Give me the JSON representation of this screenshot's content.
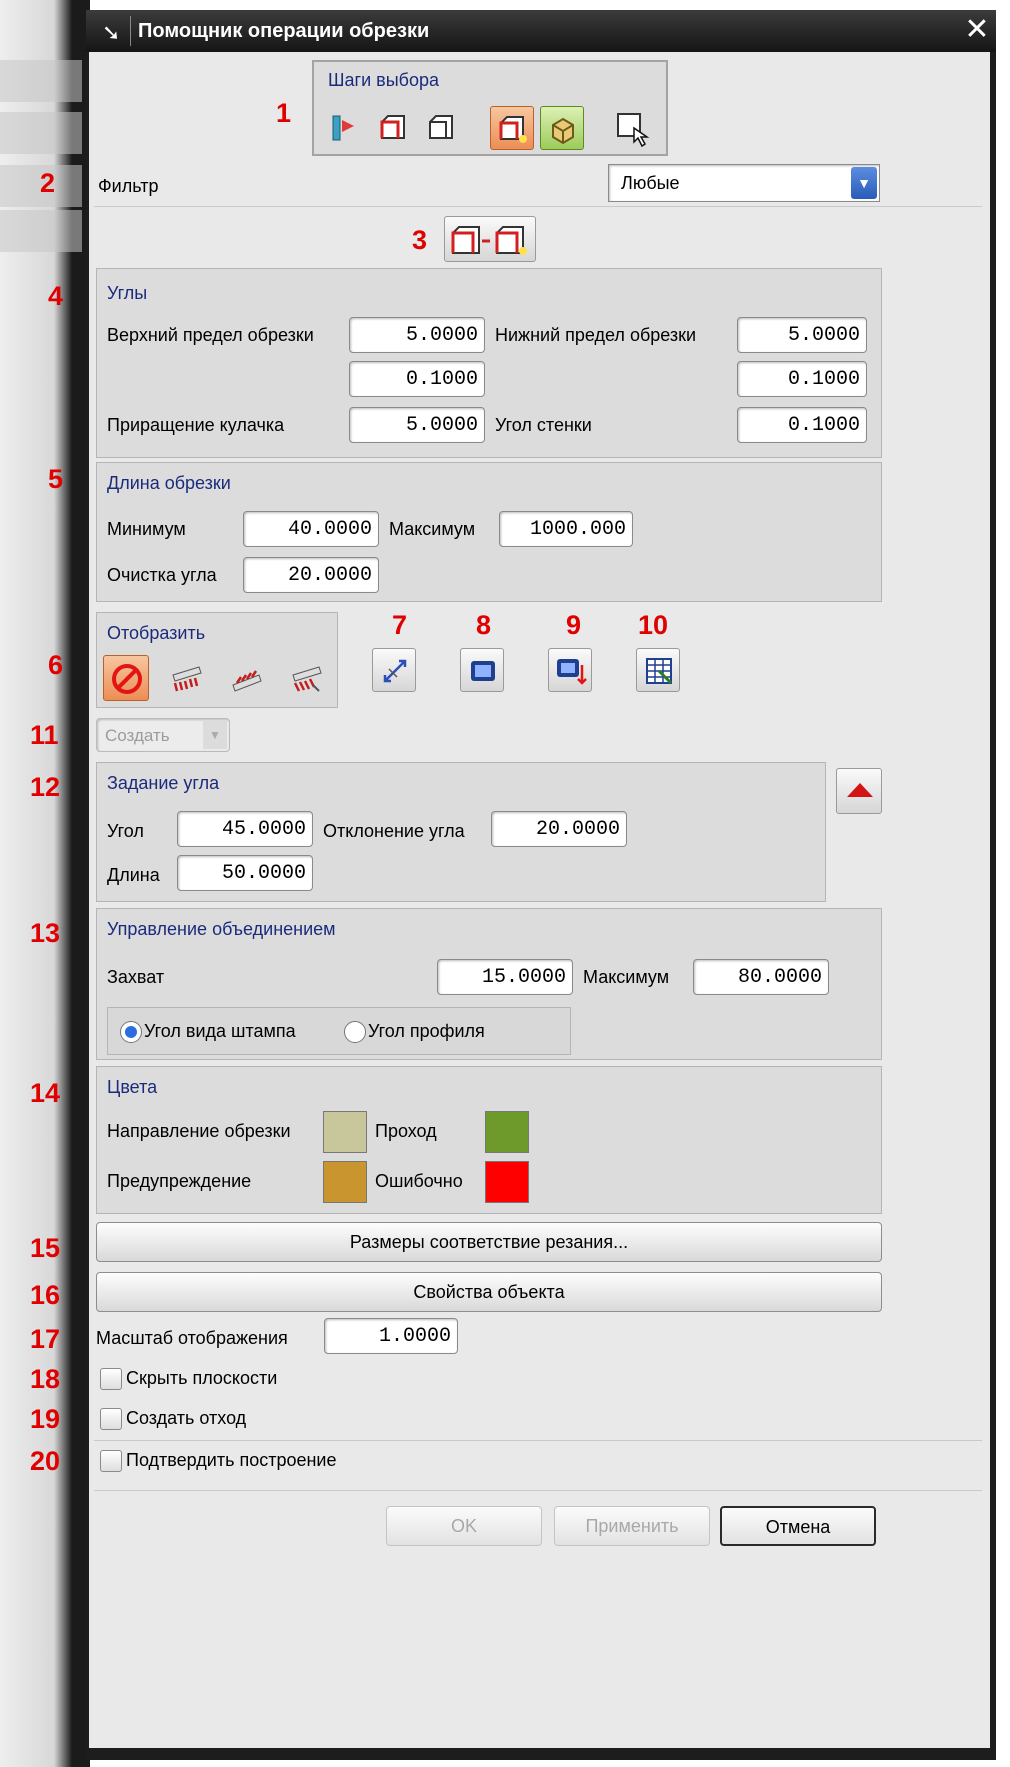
{
  "title": "Помощник операции обрезки",
  "markers": [
    "1",
    "2",
    "3",
    "4",
    "5",
    "6",
    "7",
    "8",
    "9",
    "10",
    "11",
    "12",
    "13",
    "14",
    "15",
    "16",
    "17",
    "18",
    "19",
    "20"
  ],
  "selection_steps": {
    "title": "Шаги выбора",
    "icons": [
      "sheet-edge-icon",
      "trim-face-icon",
      "trim-face-outline-icon",
      "trim-face-active-icon",
      "solid-body-icon",
      "pointer-select-icon"
    ]
  },
  "filter": {
    "label": "Фильтр",
    "value": "Любые"
  },
  "angles": {
    "title": "Углы",
    "upper_limit_label": "Верхний предел обрезки",
    "upper_limit": "5.0000",
    "upper_limit_tol": "0.1000",
    "lower_limit_label": "Нижний предел обрезки",
    "lower_limit": "5.0000",
    "lower_limit_tol": "0.1000",
    "cam_increment_label": "Приращение кулачка",
    "cam_increment": "5.0000",
    "wall_angle_label": "Угол стенки",
    "wall_angle": "0.1000"
  },
  "trim_length": {
    "title": "Длина обрезки",
    "min_label": "Минимум",
    "min": "40.0000",
    "max_label": "Максимум",
    "max": "1000.000",
    "corner_label": "Очистка угла",
    "corner": "20.0000"
  },
  "display": {
    "title": "Отобразить"
  },
  "create": {
    "value": "Создать"
  },
  "angle_setting": {
    "title": "Задание угла",
    "angle_label": "Угол",
    "angle": "45.0000",
    "deviation_label": "Отклонение угла",
    "deviation": "20.0000",
    "length_label": "Длина",
    "length": "50.0000"
  },
  "merge_control": {
    "title": "Управление объединением",
    "capture_label": "Захват",
    "capture": "15.0000",
    "max_label": "Максимум",
    "max": "80.0000",
    "radio_1": "Угол вида штампа",
    "radio_2": "Угол профиля"
  },
  "colors": {
    "title": "Цвета",
    "trim_direction_label": "Направление обрезки",
    "pass_label": "Проход",
    "warning_label": "Предупреждение",
    "error_label": "Ошибочно",
    "trim_direction_color": "#c8c79c",
    "pass_color": "#6e9a2c",
    "warning_color": "#c8952e",
    "error_color": "#ff0000"
  },
  "buttons": {
    "cut_sizes": "Размеры соответствие резания...",
    "object_properties": "Свойства объекта",
    "ok": "OK",
    "apply": "Применить",
    "cancel": "Отмена"
  },
  "scale": {
    "label": "Масштаб отображения",
    "value": "1.0000"
  },
  "checkboxes": {
    "hide_planes": "Скрыть плоскости",
    "create_scrap": "Создать отход",
    "confirm_build": "Подтвердить построение"
  }
}
